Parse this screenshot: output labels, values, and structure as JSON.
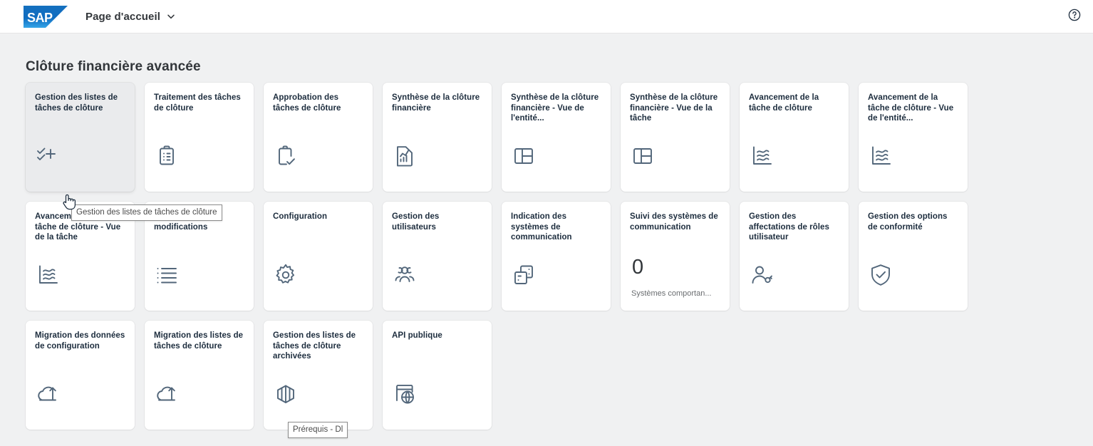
{
  "header": {
    "logo_name": "SAP",
    "title": "Page d'accueil",
    "chevron_icon": "chevron-down-icon",
    "help_icon": "help-circle-icon",
    "background": "#ffffff"
  },
  "page": {
    "section_title": "Clôture financière avancée",
    "background": "#f0f1f2",
    "tile_background": "#ffffff",
    "tile_hover_background": "#eaebed",
    "title_color": "#1d2d3e"
  },
  "tiles": [
    {
      "title": "Gestion des listes de tâches de clôture",
      "icon": "checklist-add-icon",
      "hovered": true
    },
    {
      "title": "Traitement des tâches de clôture",
      "icon": "clipboard-list-icon",
      "hovered": false
    },
    {
      "title": "Approbation des tâches de clôture",
      "icon": "clipboard-check-icon",
      "hovered": false
    },
    {
      "title": "Synthèse de la clôture financière",
      "icon": "document-chart-icon",
      "hovered": false
    },
    {
      "title": "Synthèse de la clôture financière - Vue de l'entité...",
      "icon": "layout-panel-icon",
      "hovered": false
    },
    {
      "title": "Synthèse de la clôture financière - Vue de la tâche",
      "icon": "layout-panel-icon",
      "hovered": false
    },
    {
      "title": "Avancement de la tâche de clôture",
      "icon": "line-chart-icon",
      "hovered": false
    },
    {
      "title": "Avancement de la tâche de clôture - Vue de l'entité...",
      "icon": "line-chart-icon",
      "hovered": false
    },
    {
      "title": "Avancement de la tâche de clôture - Vue de la tâche",
      "icon": "line-chart-icon",
      "hovered": false
    },
    {
      "title": "Journal des modifications",
      "icon": "bullet-list-icon",
      "hovered": false
    },
    {
      "title": "Configuration",
      "icon": "gear-icon",
      "hovered": false
    },
    {
      "title": "Gestion des utilisateurs",
      "icon": "users-group-icon",
      "hovered": false
    },
    {
      "title": "Indication des systèmes de communication",
      "icon": "communication-systems-icon",
      "hovered": false
    },
    {
      "title": "Suivi des systèmes de communication",
      "icon": "kpi-number",
      "kpi_value": "0",
      "kpi_subtitle": "Systèmes comportan...",
      "hovered": false
    },
    {
      "title": "Gestion des affectations de rôles utilisateur",
      "icon": "user-role-icon",
      "hovered": false
    },
    {
      "title": "Gestion des options de conformité",
      "icon": "shield-check-icon",
      "hovered": false
    },
    {
      "title": "Migration des données de configuration",
      "icon": "cloud-upload-icon",
      "hovered": false
    },
    {
      "title": "Migration des listes de tâches de clôture",
      "icon": "cloud-upload-icon",
      "hovered": false
    },
    {
      "title": "Gestion des listes de tâches de clôture archivées",
      "icon": "archive-box-icon",
      "hovered": false
    },
    {
      "title": "API publique",
      "icon": "api-globe-icon",
      "hovered": false
    }
  ],
  "tooltips": {
    "tile1": "Gestion des listes de tâches de clôture",
    "prerequisite": "Prérequis - Dl"
  },
  "cursor": {
    "icon": "pointer-hand-cursor"
  }
}
